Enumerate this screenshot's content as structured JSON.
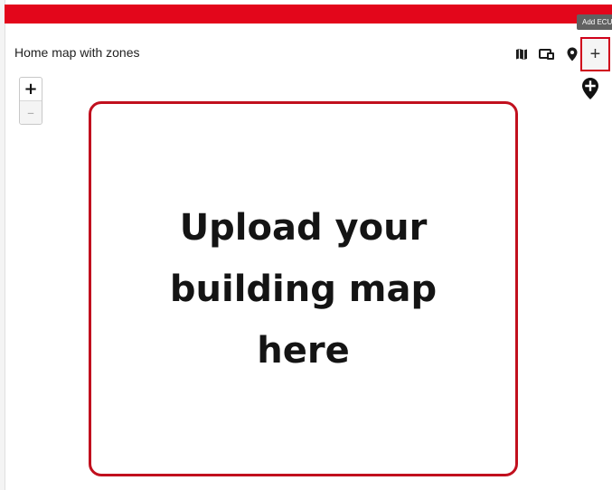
{
  "header": {
    "bar_color": "#e3061b",
    "tooltip": "Add ECU"
  },
  "card": {
    "title": "Home map with zones"
  },
  "toolbar": {
    "icons": [
      "map-icon",
      "devices-icon",
      "location-pin-icon"
    ],
    "add_label": "+",
    "add_highlight_color": "#d0021b"
  },
  "map": {
    "zoom_in_label": "+",
    "zoom_out_label": "–",
    "placeholder_text": "Upload your building map here",
    "placeholder_border_color": "#c1101e",
    "add_marker_icon": "add-location-pin-icon"
  }
}
